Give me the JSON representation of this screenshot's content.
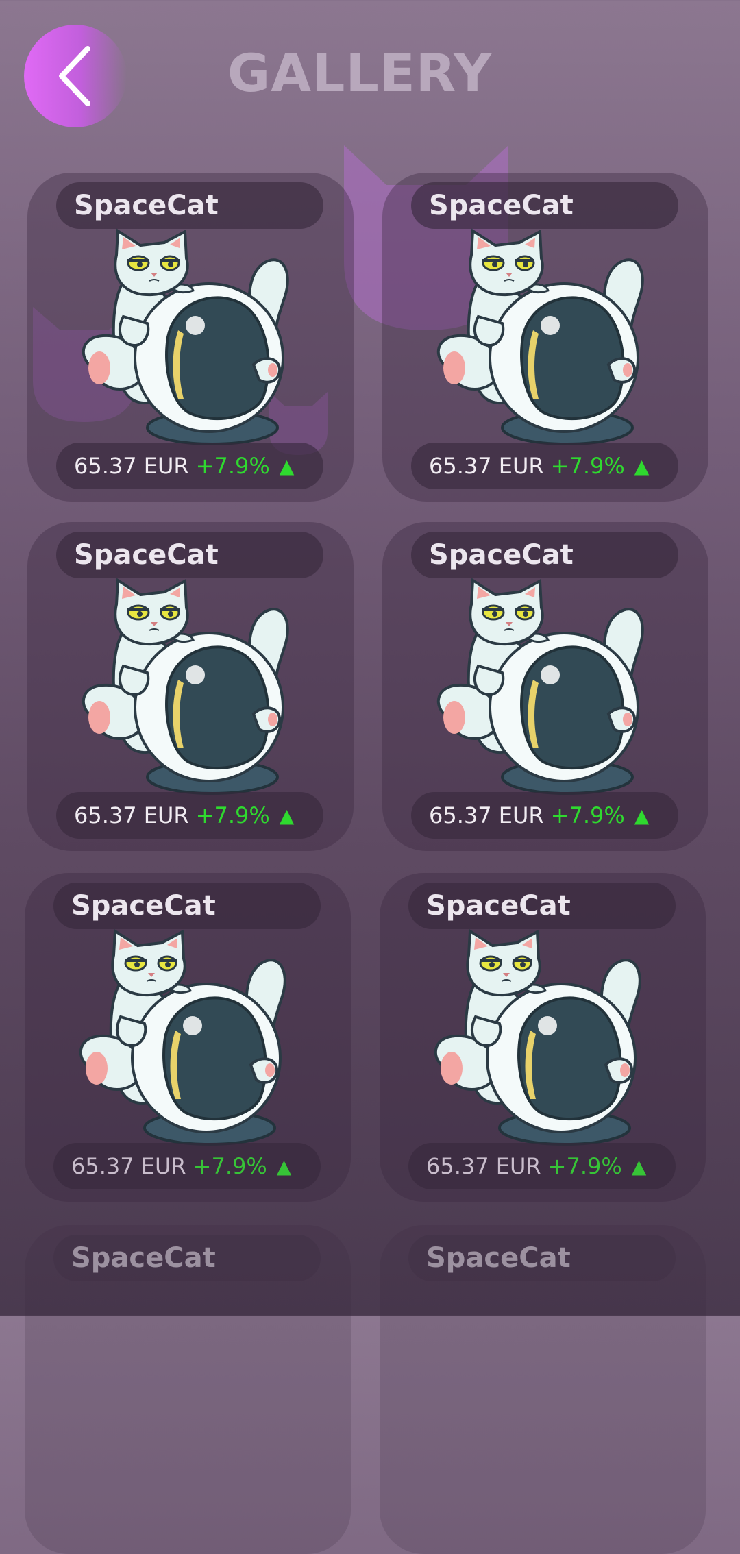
{
  "header": {
    "title": "GALLERY",
    "back_icon": "chevron-left-icon"
  },
  "colors": {
    "accent": "#d968f0",
    "positive": "#2fd92f",
    "decoration": "#b06ec8"
  },
  "items": [
    {
      "name": "SpaceCat",
      "price": "65.37 EUR",
      "change": "+7.9%",
      "trend_icon": "triangle-up-icon"
    },
    {
      "name": "SpaceCat",
      "price": "65.37 EUR",
      "change": "+7.9%",
      "trend_icon": "triangle-up-icon"
    },
    {
      "name": "SpaceCat",
      "price": "65.37 EUR",
      "change": "+7.9%",
      "trend_icon": "triangle-up-icon"
    },
    {
      "name": "SpaceCat",
      "price": "65.37 EUR",
      "change": "+7.9%",
      "trend_icon": "triangle-up-icon"
    },
    {
      "name": "SpaceCat",
      "price": "65.37 EUR",
      "change": "+7.9%",
      "trend_icon": "triangle-up-icon"
    },
    {
      "name": "SpaceCat",
      "price": "65.37 EUR",
      "change": "+7.9%",
      "trend_icon": "triangle-up-icon"
    },
    {
      "name": "SpaceCat"
    },
    {
      "name": "SpaceCat"
    }
  ]
}
